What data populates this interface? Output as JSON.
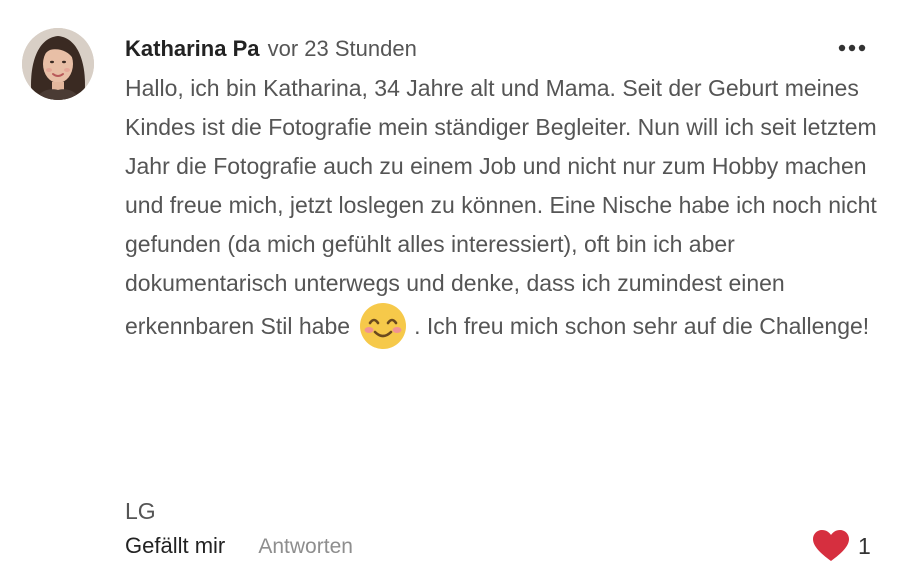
{
  "comment": {
    "author": "Katharina Pa",
    "timestamp": "vor 23 Stunden",
    "body": {
      "text_before_emoji": "Hallo, ich bin Katharina, 34 Jahre alt und Mama. Seit der Geburt meines Kindes ist die Fotografie mein ständiger Begleiter. Nun will ich seit letztem Jahr die Fotografie auch zu einem Job und nicht nur zum Hobby machen und freue mich, jetzt loslegen zu können. Eine Nische habe ich noch nicht gefunden (da mich gefühlt alles interessiert), oft bin ich aber dokumentarisch unterwegs und denke, dass ich zumindest einen erkennbaren Stil habe",
      "emoji": "smiling-face-with-smiling-eyes",
      "text_after_emoji": ". Ich freu mich schon sehr auf die Challenge!",
      "signoff": "LG"
    },
    "actions": {
      "like_label": "Gefällt mir",
      "reply_label": "Antworten"
    },
    "reactions": {
      "icon": "heart-icon",
      "count": "1",
      "color": "#d62f3f"
    },
    "more_icon": "more-horizontal-icon"
  }
}
